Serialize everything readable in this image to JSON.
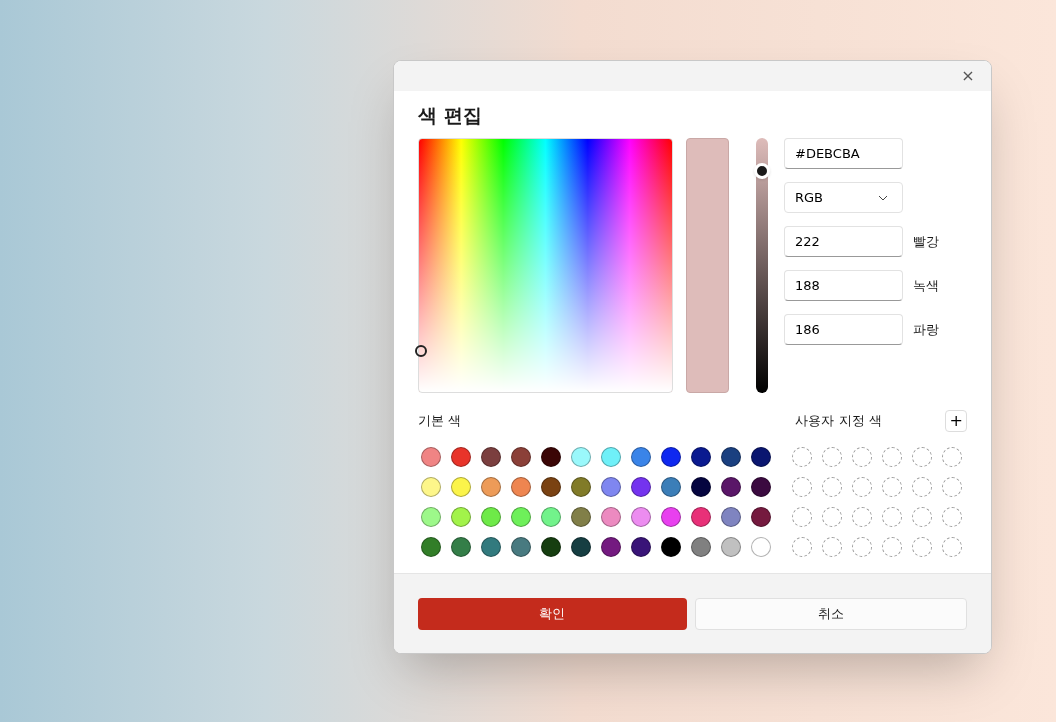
{
  "dialog": {
    "title": "색 편집",
    "close": "×"
  },
  "color": {
    "hex": "#DEBCBA",
    "mode": "RGB",
    "channels": [
      {
        "value": "222",
        "label": "빨강"
      },
      {
        "value": "188",
        "label": "녹색"
      },
      {
        "value": "186",
        "label": "파랑"
      }
    ]
  },
  "basic_colors": {
    "label": "기본 색",
    "swatches": [
      {
        "color": "#f08484"
      },
      {
        "color": "#e8342a"
      },
      {
        "color": "#7b3f3f"
      },
      {
        "color": "#8b4038"
      },
      {
        "color": "#3b0606"
      },
      {
        "color": "#9af8fb"
      },
      {
        "color": "#6ff0f8"
      },
      {
        "color": "#3a84e8"
      },
      {
        "color": "#0f28f0"
      },
      {
        "color": "#0a1a90"
      },
      {
        "color": "#1a4080"
      },
      {
        "color": "#0a1670"
      },
      {
        "color": "#fdf68a"
      },
      {
        "color": "#fbf44a"
      },
      {
        "color": "#ed9b58"
      },
      {
        "color": "#ee8550"
      },
      {
        "color": "#7a4212"
      },
      {
        "color": "#817b28"
      },
      {
        "color": "#7f86f0"
      },
      {
        "color": "#7433ef"
      },
      {
        "color": "#3b7eb8"
      },
      {
        "color": "#050540"
      },
      {
        "color": "#5a1668"
      },
      {
        "color": "#3b0a40"
      },
      {
        "color": "#9df88a"
      },
      {
        "color": "#a2f34a"
      },
      {
        "color": "#6eea48"
      },
      {
        "color": "#6ef05a"
      },
      {
        "color": "#72f38b"
      },
      {
        "color": "#817f48"
      },
      {
        "color": "#ec8ac0"
      },
      {
        "color": "#ec8cf0"
      },
      {
        "color": "#e840ef"
      },
      {
        "color": "#e83078"
      },
      {
        "color": "#7f84c0"
      },
      {
        "color": "#751a3f"
      },
      {
        "color": "#327e28"
      },
      {
        "color": "#347e48"
      },
      {
        "color": "#327a7e"
      },
      {
        "color": "#487a80"
      },
      {
        "color": "#163e10"
      },
      {
        "color": "#163e42"
      },
      {
        "color": "#741a80"
      },
      {
        "color": "#391478"
      },
      {
        "color": "#000000"
      },
      {
        "color": "#808080"
      },
      {
        "color": "#c0c0c0"
      },
      {
        "color": "#ffffff"
      }
    ]
  },
  "custom_colors": {
    "label": "사용자 지정 색",
    "add": "+",
    "slots": [
      {
        "kind": "empty"
      },
      {
        "kind": "empty"
      },
      {
        "kind": "empty"
      },
      {
        "kind": "empty"
      },
      {
        "kind": "empty"
      },
      {
        "kind": "empty"
      },
      {
        "kind": "empty"
      },
      {
        "kind": "empty"
      },
      {
        "kind": "empty"
      },
      {
        "kind": "empty"
      },
      {
        "kind": "empty"
      },
      {
        "kind": "empty"
      },
      {
        "kind": "empty"
      },
      {
        "kind": "empty"
      },
      {
        "kind": "empty"
      },
      {
        "kind": "empty"
      },
      {
        "kind": "empty"
      },
      {
        "kind": "empty"
      },
      {
        "kind": "empty"
      },
      {
        "kind": "empty"
      },
      {
        "kind": "empty"
      },
      {
        "kind": "empty"
      },
      {
        "kind": "empty"
      },
      {
        "kind": "empty"
      }
    ]
  },
  "buttons": [
    {
      "label": "확인",
      "kind": "primary"
    },
    {
      "label": "취소",
      "kind": "secondary"
    }
  ]
}
